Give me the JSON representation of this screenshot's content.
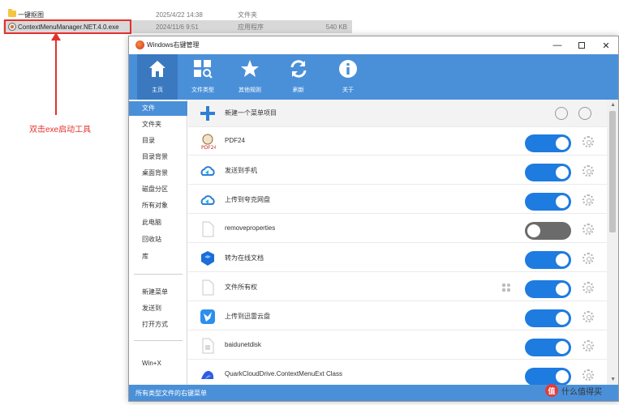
{
  "explorer": {
    "rows": [
      {
        "name": "一键抠图",
        "date": "2025/4/22 14:38",
        "type": "文件夹",
        "size": ""
      },
      {
        "name": "ContextMenuManager.NET.4.0.exe",
        "date": "2024/11/6 9:51",
        "type": "应用程序",
        "size": "540 KB"
      }
    ]
  },
  "annotation": "双击exe启动工具",
  "window": {
    "title": "Windows右键管理",
    "minimize": "—",
    "close": "✕"
  },
  "toolbar": {
    "items": [
      {
        "label": "主页",
        "icon": "home-icon"
      },
      {
        "label": "文件类型",
        "icon": "file-types-icon"
      },
      {
        "label": "其他规则",
        "icon": "star-icon"
      },
      {
        "label": "刷新",
        "icon": "refresh-icon"
      },
      {
        "label": "关于",
        "icon": "info-icon"
      }
    ]
  },
  "sidebar": {
    "items": [
      "文件",
      "文件夹",
      "目录",
      "目录背景",
      "桌面背景",
      "磁盘分区",
      "所有对象",
      "此电脑",
      "回收站",
      "库",
      "新建菜单",
      "发送到",
      "打开方式",
      "Win+X"
    ]
  },
  "content": {
    "header_label": "新建一个菜单项目",
    "rows": [
      {
        "label": "PDF24",
        "on": true,
        "icon": "pdf24-icon",
        "grid": false
      },
      {
        "label": "发送到手机",
        "on": true,
        "icon": "baidu-cloud-icon",
        "grid": false
      },
      {
        "label": "上传到夸克网盘",
        "on": true,
        "icon": "baidu-cloud-icon",
        "grid": false
      },
      {
        "label": "removeproperties",
        "on": false,
        "icon": "blank-file-icon",
        "grid": false
      },
      {
        "label": "转为在线文档",
        "on": true,
        "icon": "online-doc-icon",
        "grid": false
      },
      {
        "label": "文件所有权",
        "on": true,
        "icon": "blank-file-icon",
        "grid": true
      },
      {
        "label": "上传到迅雷云盘",
        "on": true,
        "icon": "thunder-icon",
        "grid": false
      },
      {
        "label": "baidunetdisk",
        "on": true,
        "icon": "blank-file-icon",
        "grid": false
      },
      {
        "label": "QuarkCloudDrive.ContextMenuExt Class",
        "on": true,
        "icon": "quark-icon",
        "grid": false
      }
    ]
  },
  "status": "所有类型文件的右键菜单",
  "watermark": {
    "logo": "值",
    "text": "什么值得买"
  },
  "colors": {
    "accent": "#4a90d9",
    "toggle_on": "#1e7be0",
    "toggle_off": "#6b6b6b",
    "annotation": "#e4312b"
  }
}
